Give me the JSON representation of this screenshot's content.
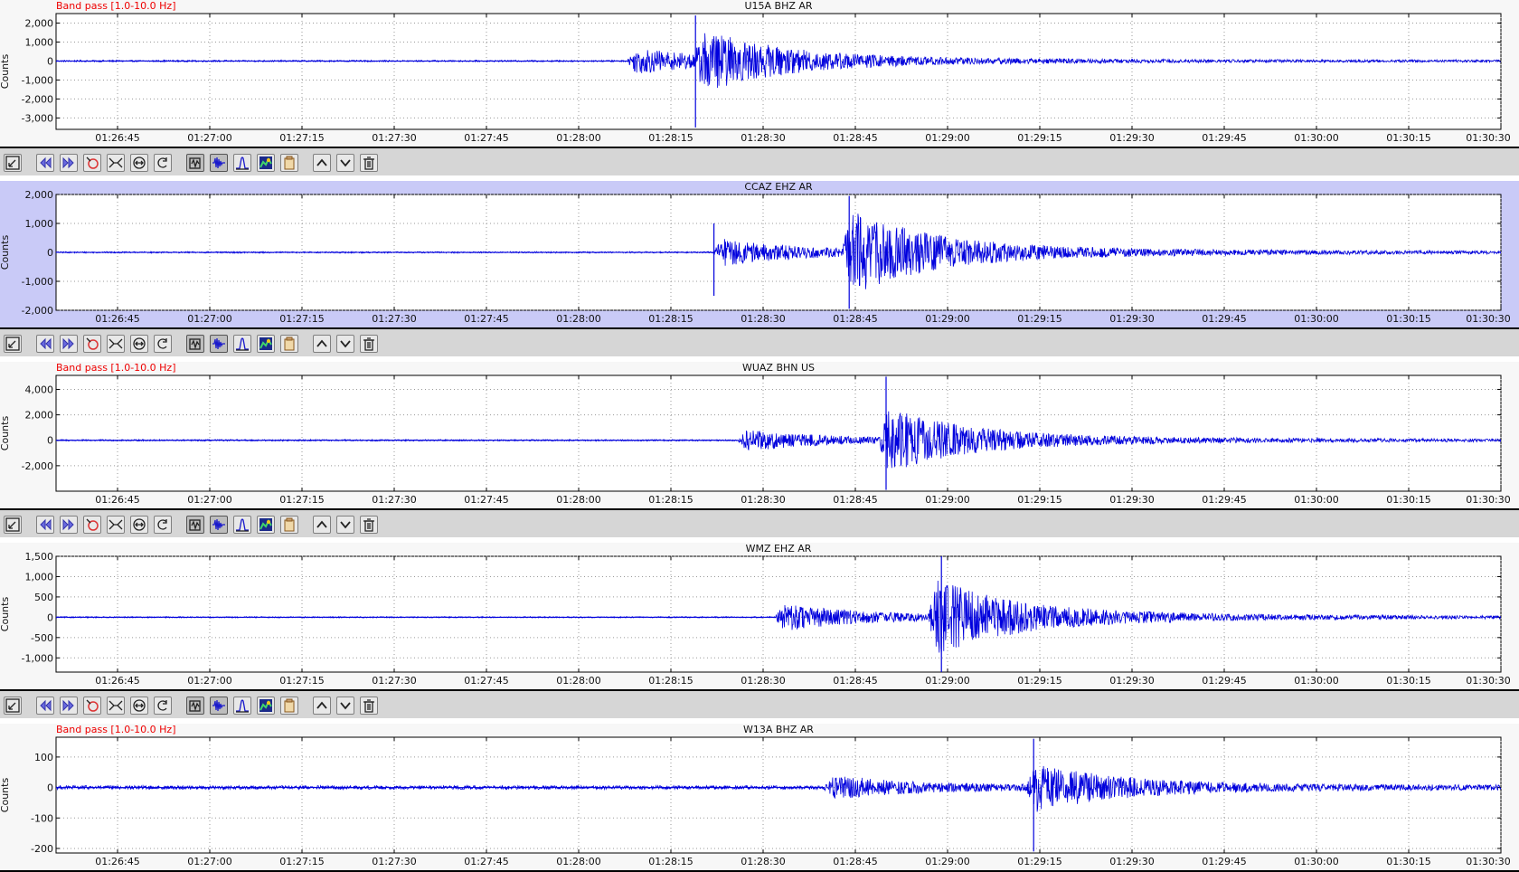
{
  "colors": {
    "trace": "#0000dd",
    "filter_label": "#ee0000",
    "selected_background": "#c9caf7"
  },
  "time_axis": {
    "start": "01:26:35",
    "end": "01:30:30",
    "tick_labels": [
      "01:26:45",
      "01:27:00",
      "01:27:15",
      "01:27:30",
      "01:27:45",
      "01:28:00",
      "01:28:15",
      "01:28:30",
      "01:28:45",
      "01:29:00",
      "01:29:15",
      "01:29:30",
      "01:29:45",
      "01:30:00",
      "01:30:15",
      "01:30:30"
    ]
  },
  "toolbar": {
    "buttons": [
      {
        "icon": "zoom-out-icon"
      },
      {
        "icon": "scroll-back-icon"
      },
      {
        "icon": "scroll-forward-icon"
      },
      {
        "icon": "pick-phase-icon"
      },
      {
        "icon": "align-icon"
      },
      {
        "icon": "expand-time-icon"
      },
      {
        "icon": "reset-icon"
      },
      {
        "icon": "filter-icon"
      },
      {
        "icon": "waveform-icon"
      },
      {
        "icon": "spectrum-icon"
      },
      {
        "icon": "spectrogram-icon"
      },
      {
        "icon": "copy-icon"
      },
      {
        "icon": "move-up-icon"
      },
      {
        "icon": "move-down-icon"
      },
      {
        "icon": "delete-icon"
      }
    ]
  },
  "panels": [
    {
      "station": "U15A BHZ AR",
      "filter": "Band pass [1.0-10.0 Hz]",
      "ylabel": "Counts",
      "selected": false,
      "yticks": [
        "2,000",
        "1,000",
        "0",
        "-1,000",
        "-2,000",
        "-3,000"
      ],
      "ytick_values": [
        2000,
        1000,
        0,
        -1000,
        -2000,
        -3000
      ],
      "ylim": [
        -3600,
        2500
      ],
      "noise": 40,
      "onset": "01:28:08",
      "events": [
        {
          "time": "01:28:08",
          "amplitude": 650
        },
        {
          "time": "01:28:19",
          "amplitude": 1300
        }
      ],
      "peaks": [
        {
          "time": "01:28:19",
          "min": -3500,
          "max": 2400
        }
      ]
    },
    {
      "station": "CCAZ EHZ AR",
      "filter": "",
      "ylabel": "Counts",
      "selected": true,
      "yticks": [
        "2,000",
        "1,000",
        "0",
        "-1,000",
        "-2,000"
      ],
      "ytick_values": [
        2000,
        1000,
        0,
        -1000,
        -2000
      ],
      "ylim": [
        -2000,
        2000
      ],
      "noise": 25,
      "onset": "01:28:22",
      "events": [
        {
          "time": "01:28:22",
          "amplitude": 450
        },
        {
          "time": "01:28:43",
          "amplitude": 1350
        }
      ],
      "peaks": [
        {
          "time": "01:28:44",
          "min": -1950,
          "max": 1950
        },
        {
          "time": "01:28:22",
          "min": -1500,
          "max": 1000
        }
      ]
    },
    {
      "station": "WUAZ BHN US",
      "filter": "Band pass [1.0-10.0 Hz]",
      "ylabel": "Counts",
      "selected": false,
      "yticks": [
        "4,000",
        "2,000",
        "0",
        "-2,000"
      ],
      "ytick_values": [
        4000,
        2000,
        0,
        -2000
      ],
      "ylim": [
        -4000,
        5100
      ],
      "noise": 60,
      "onset": "01:28:26",
      "events": [
        {
          "time": "01:28:26",
          "amplitude": 800
        },
        {
          "time": "01:28:49",
          "amplitude": 2300
        }
      ],
      "peaks": [
        {
          "time": "01:28:50",
          "min": -3900,
          "max": 5000
        }
      ]
    },
    {
      "station": "WMZ EHZ AR",
      "filter": "",
      "ylabel": "Counts",
      "selected": false,
      "yticks": [
        "1,500",
        "1,000",
        "500",
        "0",
        "-500",
        "-1,000"
      ],
      "ytick_values": [
        1500,
        1000,
        500,
        0,
        -500,
        -1000
      ],
      "ylim": [
        -1350,
        1500
      ],
      "noise": 15,
      "onset": "01:28:32",
      "events": [
        {
          "time": "01:28:32",
          "amplitude": 330
        },
        {
          "time": "01:28:57",
          "amplitude": 850
        }
      ],
      "peaks": [
        {
          "time": "01:28:59",
          "min": -1350,
          "max": 1500
        }
      ]
    },
    {
      "station": "W13A BHZ AR",
      "filter": "Band pass [1.0-10.0 Hz]",
      "ylabel": "Counts",
      "selected": false,
      "yticks": [
        "100",
        "0",
        "-100",
        "-200"
      ],
      "ytick_values": [
        100,
        0,
        -100,
        -200
      ],
      "ylim": [
        -215,
        165
      ],
      "noise": 6,
      "onset": "01:28:40",
      "events": [
        {
          "time": "01:28:40",
          "amplitude": 35
        },
        {
          "time": "01:29:13",
          "amplitude": 70
        }
      ],
      "peaks": [
        {
          "time": "01:29:14",
          "min": -210,
          "max": 160
        }
      ]
    }
  ]
}
